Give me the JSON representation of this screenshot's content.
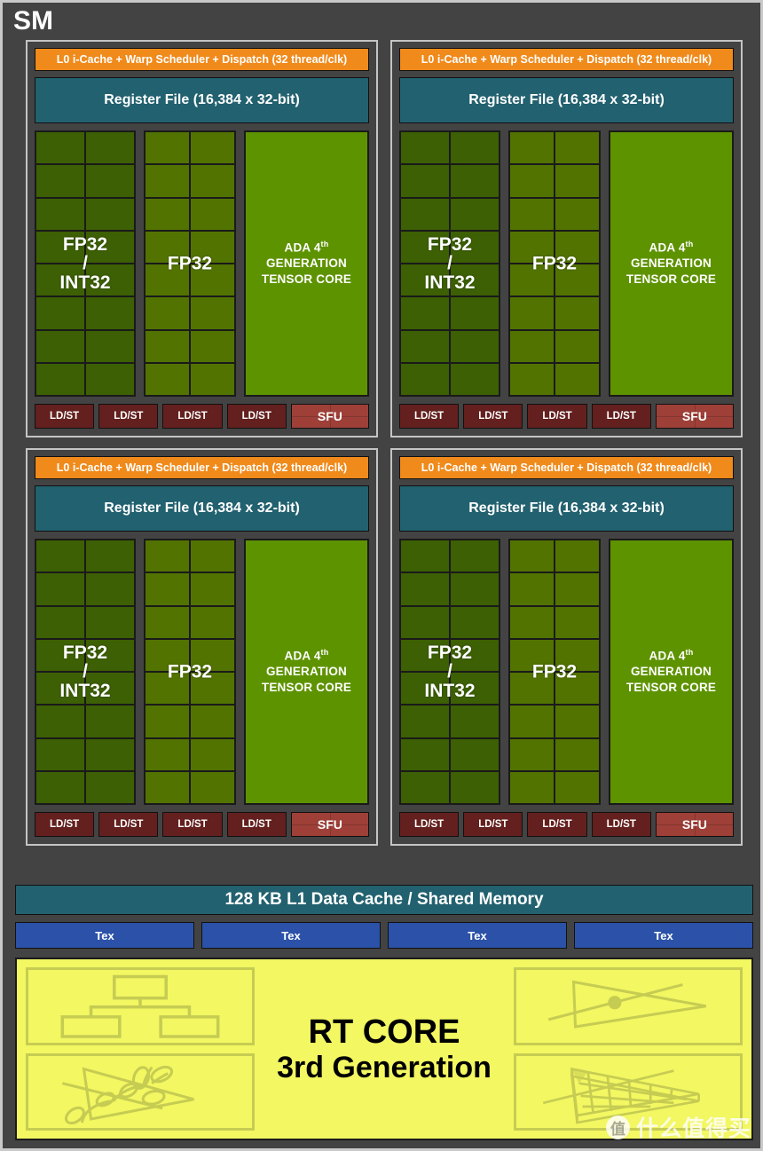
{
  "diagram": {
    "title": "SM",
    "colors": {
      "background": "#434343",
      "l0_bar": "#f08a1b",
      "register_file": "#22616f",
      "fp32_int32_core": "#3c6003",
      "fp32_core": "#527300",
      "tensor_core": "#5e9300",
      "ldst": "#63201e",
      "sfu": "#9e4038",
      "l1_cache": "#22616f",
      "tex": "#2b52a8",
      "rt_core": "#f2f762",
      "panel_border": "#c4c4c4"
    }
  },
  "partition": {
    "l0_label": "L0 i-Cache + Warp Scheduler + Dispatch (32 thread/clk)",
    "register_file_label": "Register File (16,384 x 32-bit)",
    "fp32_int32_label_line1": "FP32",
    "fp32_int32_label_line2": "/",
    "fp32_int32_label_line3": "INT32",
    "fp32_label": "FP32",
    "tensor_core_line1_pre": "ADA 4",
    "tensor_core_line1_sup": "th",
    "tensor_core_line2": "GENERATION",
    "tensor_core_line3": "TENSOR CORE",
    "ldst_label": "LD/ST",
    "sfu_label": "SFU",
    "ldst_count": 4,
    "core_rows": 8,
    "core_cols": 2
  },
  "shared": {
    "l1_cache_label": "128 KB L1 Data Cache / Shared Memory",
    "tex_label": "Tex",
    "tex_count": 4
  },
  "rt_core": {
    "title": "RT CORE",
    "subtitle": "3rd Generation",
    "icons": [
      "bvh-tree-icon",
      "ray-triangle-intersection-icon",
      "opacity-micromap-foliage-icon",
      "displaced-micro-mesh-icon"
    ]
  },
  "watermark": {
    "logo_glyph": "值",
    "text": "什么值得买"
  }
}
